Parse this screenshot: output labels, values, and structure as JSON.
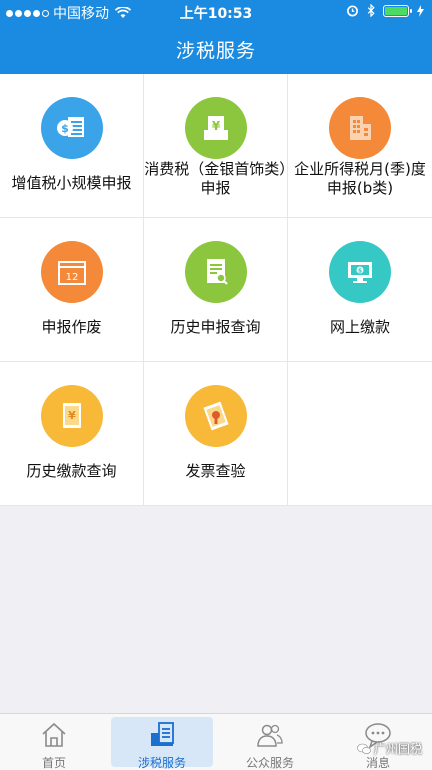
{
  "status_bar": {
    "carrier": "中国移动",
    "time": "上午10:53"
  },
  "header": {
    "title": "涉税服务"
  },
  "services": [
    {
      "label": "增值税小规模申报",
      "icon": "coin-document-icon",
      "color": "#3ba4e8"
    },
    {
      "label": "消费税（金银首饰类）申报",
      "icon": "yen-tray-icon",
      "color": "#8cc63e"
    },
    {
      "label": "企业所得税月(季)度申报(b类)",
      "icon": "building-icon",
      "color": "#f5893a"
    },
    {
      "label": "申报作废",
      "icon": "calendar-icon",
      "color": "#f5893a"
    },
    {
      "label": "历史申报查询",
      "icon": "document-search-icon",
      "color": "#8cc63e"
    },
    {
      "label": "网上缴款",
      "icon": "monitor-payment-icon",
      "color": "#35c8c4"
    },
    {
      "label": "历史缴款查询",
      "icon": "yen-notebook-icon",
      "color": "#f8b938"
    },
    {
      "label": "发票查验",
      "icon": "invoice-stamp-icon",
      "color": "#f8b938"
    }
  ],
  "tabs": [
    {
      "label": "首页",
      "icon": "home-icon"
    },
    {
      "label": "涉税服务",
      "icon": "tax-service-icon",
      "active": true
    },
    {
      "label": "公众服务",
      "icon": "people-icon"
    },
    {
      "label": "消息",
      "icon": "chat-bubble-icon"
    }
  ],
  "watermark": "广州国税",
  "colors": {
    "header": "#1a8be0",
    "active_tab": "#1a6fcf"
  }
}
